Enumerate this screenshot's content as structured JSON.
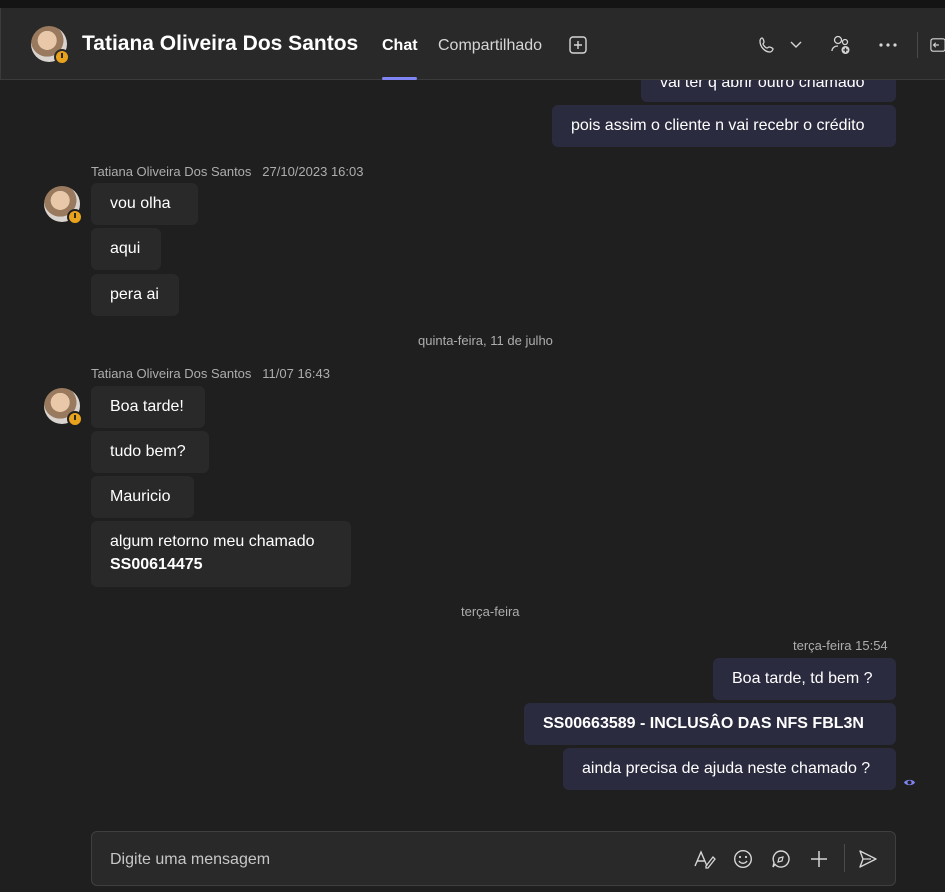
{
  "header": {
    "title": "Tatiana Oliveira Dos Santos",
    "tabs": [
      {
        "label": "Chat",
        "active": true
      },
      {
        "label": "Compartilhado",
        "active": false
      }
    ],
    "icons": [
      "add-tab-icon",
      "phone-icon",
      "chevron-down-icon",
      "people-add-icon",
      "more-icon",
      "popout-icon"
    ]
  },
  "messages": {
    "partial_top": "vai ter q abrir outro chamado",
    "out_top": "pois assim o cliente n vai recebr o crédito",
    "group1": {
      "sender": "Tatiana Oliveira Dos Santos",
      "time": "27/10/2023 16:03",
      "items": [
        "vou olha",
        "aqui",
        "pera ai"
      ]
    },
    "day_divider_1": "quinta-feira, 11 de julho",
    "group2": {
      "sender": "Tatiana Oliveira Dos Santos",
      "time": "11/07 16:43",
      "items": [
        "Boa tarde!",
        "tudo bem?",
        "Mauricio"
      ],
      "last_line1": "algum retorno meu chamado",
      "last_line2": "SS00614475"
    },
    "day_divider_2": "terça-feira",
    "group3": {
      "time": "terça-feira 15:54",
      "items": [
        "Boa tarde, td bem ?",
        "SS00663589 - INCLUSÂO DAS NFS FBL3N",
        "ainda precisa de ajuda neste chamado ?"
      ]
    }
  },
  "composer": {
    "placeholder": "Digite uma mensagem",
    "icons": [
      "format-icon",
      "emoji-icon",
      "loop-icon",
      "attach-plus-icon",
      "send-icon"
    ]
  },
  "colors": {
    "background": "#1f1f1f",
    "incoming_bubble": "#292929",
    "outgoing_bubble": "#2b2b40",
    "accent": "#7f85f5",
    "away_status": "#e9a21c"
  }
}
